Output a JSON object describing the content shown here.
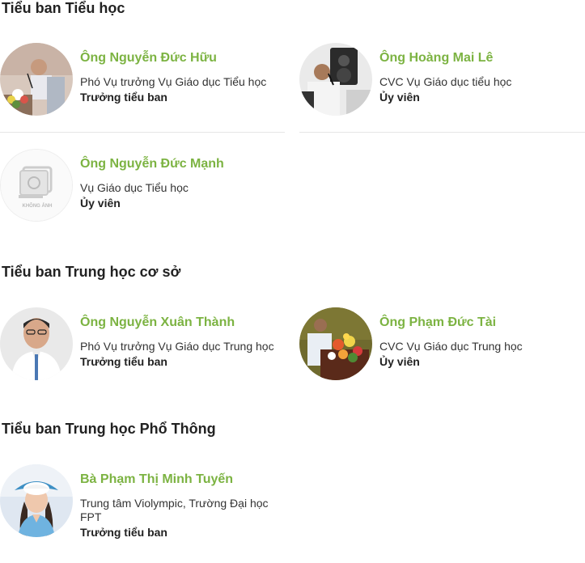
{
  "sections": [
    {
      "title": "Tiểu ban Tiểu học",
      "members": [
        {
          "name": "Ông Nguyễn Đức Hữu",
          "position": "Phó Vụ trưởng Vụ Giáo dục Tiểu học",
          "role": "Trưởng tiểu ban",
          "photo": "speaker-podium-photo"
        },
        {
          "name": "Ông Hoàng Mai Lê",
          "position": "CVC Vụ Giáo dục tiểu học",
          "role": "Ủy viên",
          "photo": "speaker-microphone-photo"
        },
        {
          "name": "Ông Nguyễn Đức Mạnh",
          "position": "Vụ Giáo dục Tiểu học",
          "role": "Ủy viên",
          "photo": "no-photo-placeholder",
          "placeholder_text": "KHÔNG ẢNH"
        }
      ]
    },
    {
      "title": "Tiểu ban Trung học cơ sở",
      "members": [
        {
          "name": "Ông Nguyễn Xuân Thành",
          "position": "Phó Vụ trưởng Vụ Giáo dục Trung học",
          "role": "Trưởng tiểu ban",
          "photo": "portrait-photo"
        },
        {
          "name": "Ông Phạm Đức Tài",
          "position": "CVC Vụ Giáo dục Trung học",
          "role": "Ủy viên",
          "photo": "speaker-flowers-photo"
        }
      ]
    },
    {
      "title": "Tiểu ban Trung học Phổ Thông",
      "members": [
        {
          "name": "Bà Phạm Thị Minh Tuyến",
          "position": "Trung tâm Violympic, Trường Đại học FPT",
          "role": "Trưởng tiểu ban",
          "photo": "woman-hat-photo"
        }
      ]
    }
  ],
  "colors": {
    "name": "#7cb342",
    "heading": "#222222",
    "text": "#333333",
    "divider": "#e6e6e6"
  }
}
